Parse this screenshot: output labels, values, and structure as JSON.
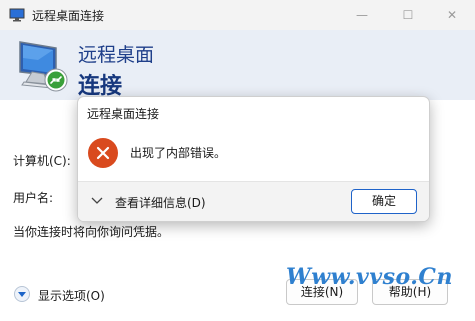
{
  "window": {
    "title": "远程桌面连接",
    "header_line1": "远程桌面",
    "header_line2": "连接",
    "minimize_glyph": "—",
    "maximize_glyph": "☐",
    "close_glyph": "✕"
  },
  "form": {
    "computer_label": "计算机(C):",
    "user_label": "用户名:",
    "note": "当你连接时将向你询问凭据。",
    "options_label": "显示选项(O)",
    "connect_label": "连接(N)",
    "help_label": "帮助(H)"
  },
  "dialog": {
    "title": "远程桌面连接",
    "message": "出现了内部错误。",
    "details_label": "查看详细信息(D)",
    "ok_label": "确定"
  },
  "watermark": "Www.vvso.Cn",
  "colors": {
    "accent": "#1f63c9",
    "header_text": "#1f3f8a",
    "error": "#d94a1e",
    "watermark": "#2f80cf"
  },
  "icons": {
    "app": "remote-desktop-icon",
    "error": "error-icon",
    "details": "chevron-down-icon",
    "options": "expand-circle-icon"
  }
}
